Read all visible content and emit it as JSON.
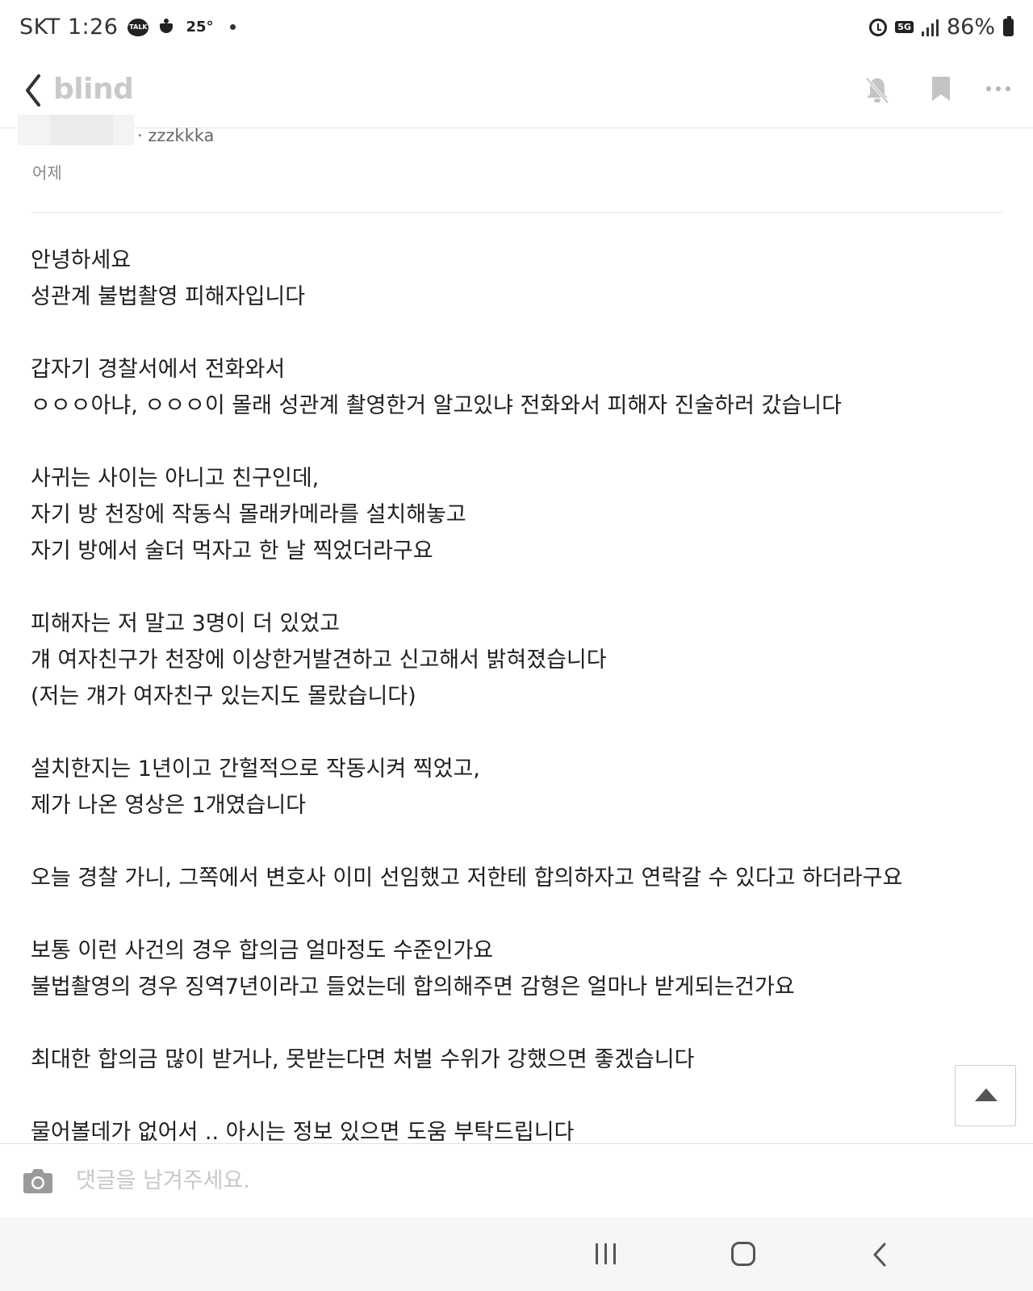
{
  "status_bar": {
    "carrier_time": "SKT 1:26",
    "talk_badge": "TALK",
    "temperature": "25°",
    "network": "5G",
    "battery": "86%"
  },
  "app_bar": {
    "logo": "blind"
  },
  "post": {
    "author": "· zzzkkka",
    "time": "어제",
    "paragraphs": [
      [
        "안녕하세요",
        "성관계 불법촬영 피해자입니다"
      ],
      [
        "갑자기 경찰서에서 전화와서",
        "ㅇㅇㅇ아냐, ㅇㅇㅇ이 몰래 성관계 촬영한거 알고있냐 전화와서 피해자 진술하러 갔습니다"
      ],
      [
        "사귀는 사이는 아니고 친구인데,",
        "자기 방 천장에 작동식 몰래카메라를 설치해놓고",
        "자기 방에서 술더 먹자고 한 날 찍었더라구요"
      ],
      [
        "피해자는 저 말고 3명이 더 있었고",
        "걔 여자친구가 천장에 이상한거발견하고 신고해서 밝혀졌습니다",
        "(저는 걔가 여자친구 있는지도 몰랐습니다)"
      ],
      [
        "설치한지는 1년이고 간헐적으로 작동시켜 찍었고,",
        "제가 나온 영상은 1개였습니다"
      ],
      [
        "오늘 경찰 가니, 그쪽에서 변호사 이미 선임했고 저한테 합의하자고 연락갈 수 있다고 하더라구요"
      ],
      [
        "보통 이런 사건의 경우 합의금 얼마정도 수준인가요",
        "불법촬영의 경우 징역7년이라고 들었는데 합의해주면 감형은 얼마나 받게되는건가요"
      ],
      [
        "최대한 합의금 많이 받거나, 못받는다면 처벌 수위가 강했으면 좋겠습니다"
      ],
      [
        "물어볼데가 없어서 .. 아시는 정보 있으면 도움 부탁드립니다"
      ]
    ]
  },
  "comment_bar": {
    "placeholder": "댓글을 남겨주세요."
  }
}
